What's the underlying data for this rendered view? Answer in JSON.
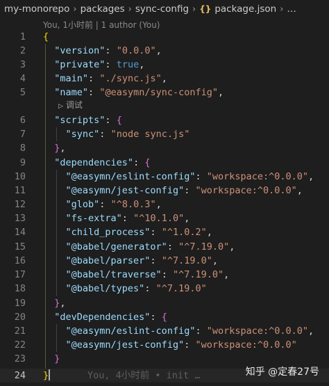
{
  "breadcrumb": {
    "items": [
      "my-monorepo",
      "packages",
      "sync-config"
    ],
    "file_icon": "{}",
    "file": "package.json",
    "more": "…"
  },
  "blame": "You, 1小时前 | 1 author (You)",
  "codelens": "调试",
  "inline_blame": "You, 4小时前 • init …",
  "watermark": "知乎 @定春27号",
  "lines": [
    {
      "n": "1",
      "tokens": [
        {
          "t": "{",
          "c": "br1"
        }
      ]
    },
    {
      "n": "2",
      "tokens": [
        {
          "t": "  "
        },
        {
          "t": "\"version\"",
          "c": "k"
        },
        {
          "t": ": "
        },
        {
          "t": "\"0.0.0\"",
          "c": "s"
        },
        {
          "t": ","
        }
      ]
    },
    {
      "n": "3",
      "tokens": [
        {
          "t": "  "
        },
        {
          "t": "\"private\"",
          "c": "k"
        },
        {
          "t": ": "
        },
        {
          "t": "true",
          "c": "b"
        },
        {
          "t": ","
        }
      ]
    },
    {
      "n": "4",
      "tokens": [
        {
          "t": "  "
        },
        {
          "t": "\"main\"",
          "c": "k"
        },
        {
          "t": ": "
        },
        {
          "t": "\"./sync.js\"",
          "c": "s"
        },
        {
          "t": ","
        }
      ]
    },
    {
      "n": "5",
      "tokens": [
        {
          "t": "  "
        },
        {
          "t": "\"name\"",
          "c": "k"
        },
        {
          "t": ": "
        },
        {
          "t": "\"@easymn/sync-config\"",
          "c": "s"
        },
        {
          "t": ","
        }
      ]
    },
    {
      "n": "6",
      "tokens": [
        {
          "t": "  "
        },
        {
          "t": "\"scripts\"",
          "c": "k"
        },
        {
          "t": ": "
        },
        {
          "t": "{",
          "c": "br2"
        }
      ]
    },
    {
      "n": "7",
      "tokens": [
        {
          "t": "    "
        },
        {
          "t": "\"sync\"",
          "c": "k"
        },
        {
          "t": ": "
        },
        {
          "t": "\"node sync.js\"",
          "c": "s"
        }
      ]
    },
    {
      "n": "8",
      "tokens": [
        {
          "t": "  "
        },
        {
          "t": "}",
          "c": "br2"
        },
        {
          "t": ","
        }
      ]
    },
    {
      "n": "9",
      "tokens": [
        {
          "t": "  "
        },
        {
          "t": "\"dependencies\"",
          "c": "k"
        },
        {
          "t": ": "
        },
        {
          "t": "{",
          "c": "br2"
        }
      ]
    },
    {
      "n": "10",
      "tokens": [
        {
          "t": "    "
        },
        {
          "t": "\"@easymn/eslint-config\"",
          "c": "k"
        },
        {
          "t": ": "
        },
        {
          "t": "\"workspace:^0.0.0\"",
          "c": "s"
        },
        {
          "t": ","
        }
      ]
    },
    {
      "n": "11",
      "tokens": [
        {
          "t": "    "
        },
        {
          "t": "\"@easymn/jest-config\"",
          "c": "k"
        },
        {
          "t": ": "
        },
        {
          "t": "\"workspace:^0.0.0\"",
          "c": "s"
        },
        {
          "t": ","
        }
      ]
    },
    {
      "n": "12",
      "tokens": [
        {
          "t": "    "
        },
        {
          "t": "\"glob\"",
          "c": "k"
        },
        {
          "t": ": "
        },
        {
          "t": "\"^8.0.3\"",
          "c": "s"
        },
        {
          "t": ","
        }
      ]
    },
    {
      "n": "13",
      "tokens": [
        {
          "t": "    "
        },
        {
          "t": "\"fs-extra\"",
          "c": "k"
        },
        {
          "t": ": "
        },
        {
          "t": "\"^10.1.0\"",
          "c": "s"
        },
        {
          "t": ","
        }
      ]
    },
    {
      "n": "14",
      "tokens": [
        {
          "t": "    "
        },
        {
          "t": "\"child_process\"",
          "c": "k"
        },
        {
          "t": ": "
        },
        {
          "t": "\"^1.0.2\"",
          "c": "s"
        },
        {
          "t": ","
        }
      ]
    },
    {
      "n": "15",
      "tokens": [
        {
          "t": "    "
        },
        {
          "t": "\"@babel/generator\"",
          "c": "k"
        },
        {
          "t": ": "
        },
        {
          "t": "\"^7.19.0\"",
          "c": "s"
        },
        {
          "t": ","
        }
      ]
    },
    {
      "n": "16",
      "tokens": [
        {
          "t": "    "
        },
        {
          "t": "\"@babel/parser\"",
          "c": "k"
        },
        {
          "t": ": "
        },
        {
          "t": "\"^7.19.0\"",
          "c": "s"
        },
        {
          "t": ","
        }
      ]
    },
    {
      "n": "17",
      "tokens": [
        {
          "t": "    "
        },
        {
          "t": "\"@babel/traverse\"",
          "c": "k"
        },
        {
          "t": ": "
        },
        {
          "t": "\"^7.19.0\"",
          "c": "s"
        },
        {
          "t": ","
        }
      ]
    },
    {
      "n": "18",
      "tokens": [
        {
          "t": "    "
        },
        {
          "t": "\"@babel/types\"",
          "c": "k"
        },
        {
          "t": ": "
        },
        {
          "t": "\"^7.19.0\"",
          "c": "s"
        }
      ]
    },
    {
      "n": "19",
      "tokens": [
        {
          "t": "  "
        },
        {
          "t": "}",
          "c": "br2"
        },
        {
          "t": ","
        }
      ]
    },
    {
      "n": "20",
      "tokens": [
        {
          "t": "  "
        },
        {
          "t": "\"devDependencies\"",
          "c": "k"
        },
        {
          "t": ": "
        },
        {
          "t": "{",
          "c": "br2"
        }
      ]
    },
    {
      "n": "21",
      "tokens": [
        {
          "t": "    "
        },
        {
          "t": "\"@easymn/eslint-config\"",
          "c": "k"
        },
        {
          "t": ": "
        },
        {
          "t": "\"workspace:^0.0.0\"",
          "c": "s"
        },
        {
          "t": ","
        }
      ]
    },
    {
      "n": "22",
      "tokens": [
        {
          "t": "    "
        },
        {
          "t": "\"@easymn/jest-config\"",
          "c": "k"
        },
        {
          "t": ": "
        },
        {
          "t": "\"workspace:^0.0.0\"",
          "c": "s"
        }
      ]
    },
    {
      "n": "23",
      "tokens": [
        {
          "t": "  "
        },
        {
          "t": "}",
          "c": "br2"
        }
      ]
    },
    {
      "n": "24",
      "tokens": [
        {
          "t": "}",
          "c": "br1"
        }
      ]
    }
  ]
}
